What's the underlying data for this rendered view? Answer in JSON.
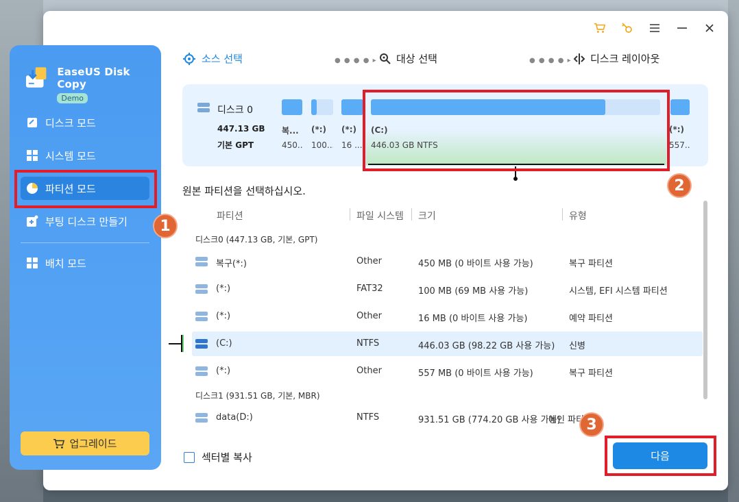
{
  "app": {
    "name": "EaseUS Disk Copy",
    "badge": "Demo"
  },
  "sidebar": {
    "items": [
      {
        "label": "디스크 모드",
        "icon": "disk-mode-icon"
      },
      {
        "label": "시스템 모드",
        "icon": "windows-icon"
      },
      {
        "label": "파티션 모드",
        "icon": "pie-chart-icon",
        "active": true
      },
      {
        "label": "부팅 디스크 만들기",
        "icon": "boot-disk-icon"
      },
      {
        "label": "배치 모드",
        "icon": "grid-icon"
      }
    ],
    "upgrade_label": "업그레이드"
  },
  "steps": [
    {
      "label": "소스 선택",
      "icon": "target-icon"
    },
    {
      "label": "대상 선택",
      "icon": "search-target-icon"
    },
    {
      "label": "디스크 레이아웃",
      "icon": "layout-icon"
    }
  ],
  "disk_panel": {
    "disk_name": "디스크 0",
    "size": "447.13 GB",
    "type": "기본 GPT",
    "parts": [
      {
        "name": "복...",
        "size": "450..."
      },
      {
        "name": "(*:)",
        "size": "100..."
      },
      {
        "name": "(*:)",
        "size": "16 ..."
      },
      {
        "name": "(C:)",
        "size": "446.03 GB NTFS",
        "used_fraction": 0.81
      },
      {
        "name": "(*:)",
        "size": "557..."
      }
    ]
  },
  "source_prompt": "원본 파티션을 선택하십시오.",
  "table": {
    "headers": [
      "파티션",
      "파일 시스템",
      "크기",
      "유형"
    ],
    "groups": [
      {
        "label": "디스크0 (447.13 GB, 기본, GPT)",
        "rows": [
          {
            "name": "복구(*:)",
            "fs": "Other",
            "size": "450 MB (0 바이트 사용 가능)",
            "type": "복구 파티션"
          },
          {
            "name": "(*:)",
            "fs": "FAT32",
            "size": "100 MB (69 MB 사용 가능)",
            "type": "시스템, EFI 시스템 파티션"
          },
          {
            "name": "(*:)",
            "fs": "Other",
            "size": "16 MB (0 바이트 사용 가능)",
            "type": "예약 파티션"
          },
          {
            "name": "(C:)",
            "fs": "NTFS",
            "size": "446.03 GB (98.22 GB 사용 가능)",
            "type": "신병",
            "selected": true
          },
          {
            "name": "(*:)",
            "fs": "Other",
            "size": "557 MB (0 바이트 사용 가능)",
            "type": "복구 파티션"
          }
        ]
      },
      {
        "label": "디스크1 (931.51 GB, 기본, MBR)",
        "rows": [
          {
            "name": "data(D:)",
            "fs": "NTFS",
            "size": "931.51 GB (774.20 GB 사용 가능)",
            "type": "메인 파티션"
          }
        ]
      }
    ]
  },
  "sector_copy_label": "섹터별 복사",
  "next_label": "다음",
  "markers": [
    "1",
    "2",
    "3"
  ],
  "colors": {
    "accent": "#1e88e5",
    "sidebar": "#4a9bf1",
    "highlight": "#e21d2a",
    "marker": "#e06634",
    "upgrade": "#fbcc4d"
  }
}
